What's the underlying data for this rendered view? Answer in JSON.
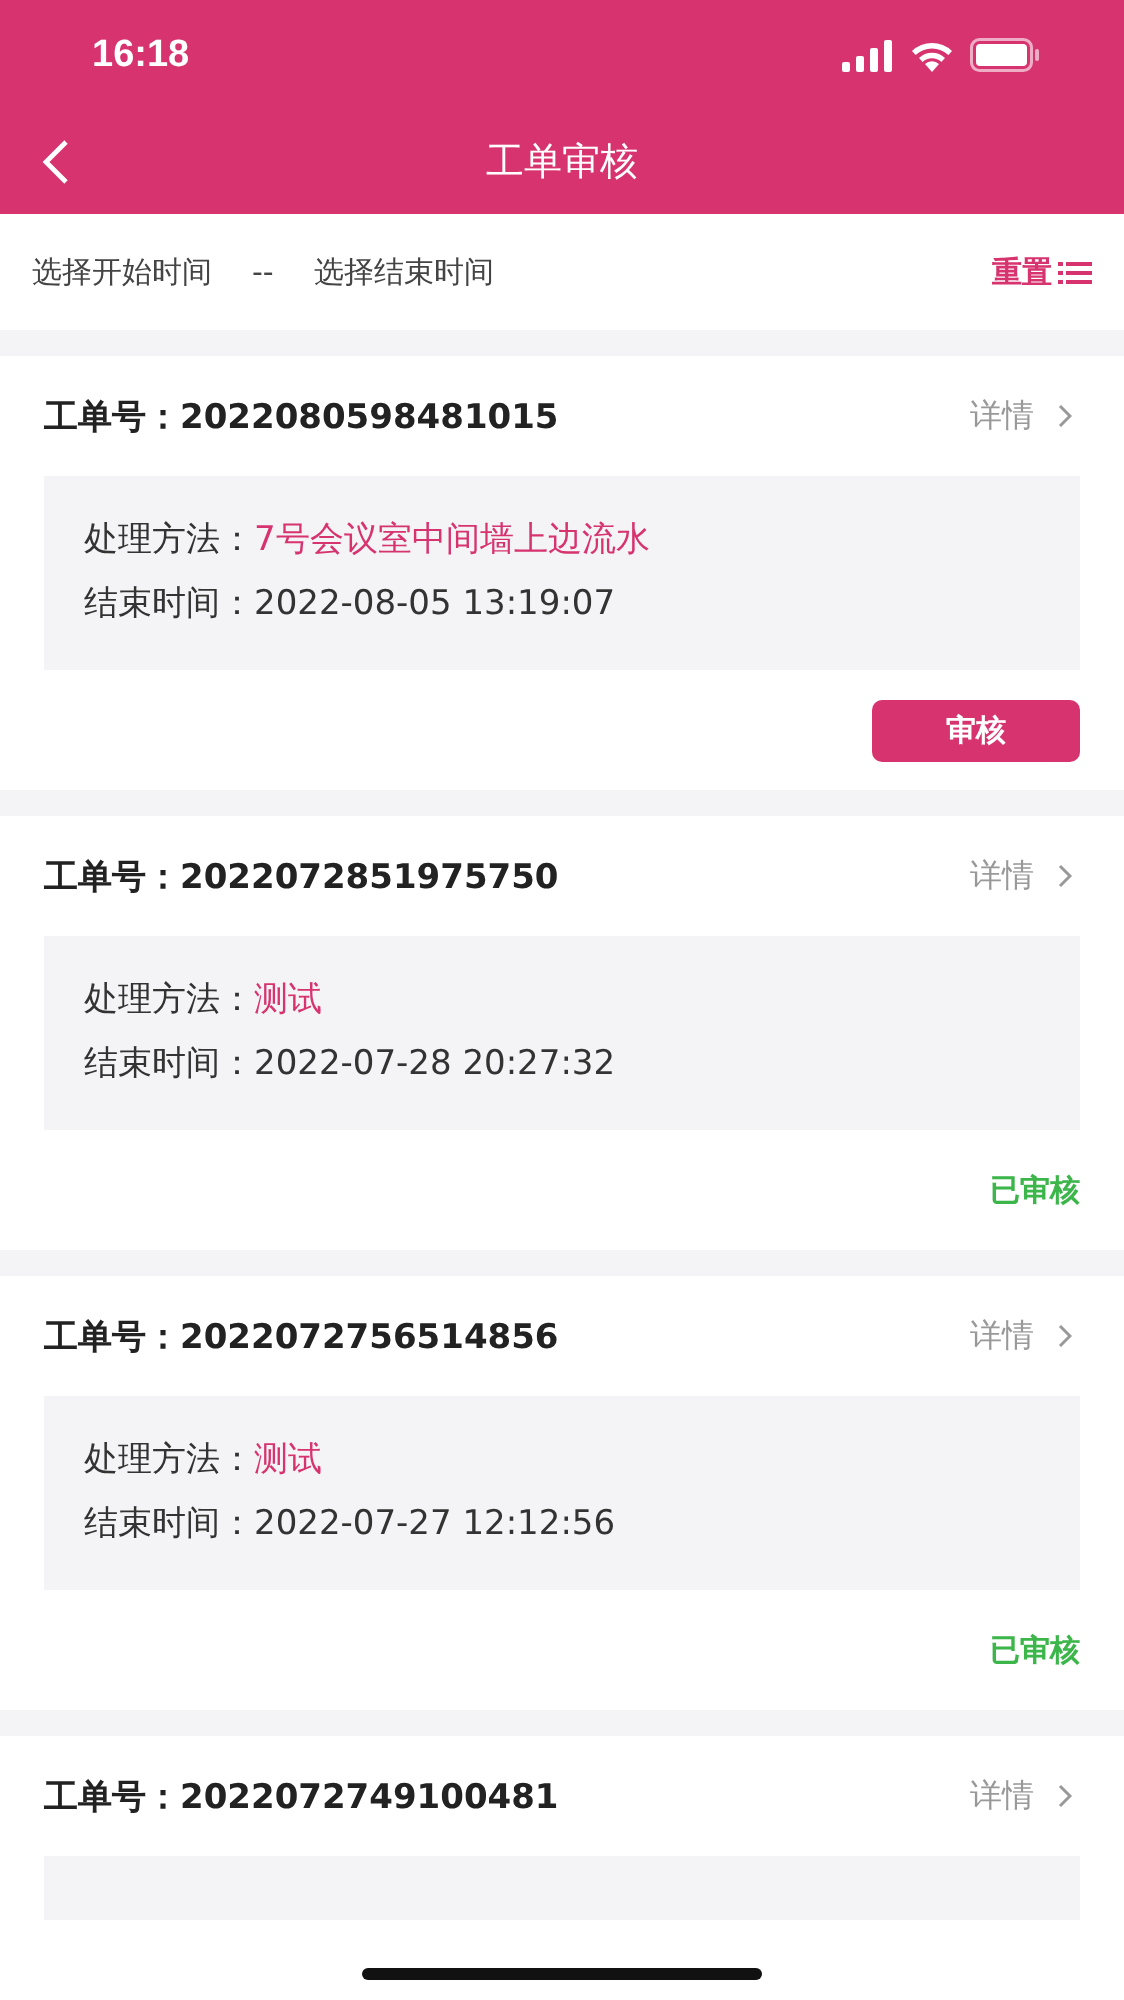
{
  "status_bar": {
    "time": "16:18"
  },
  "nav": {
    "title": "工单审核"
  },
  "filter": {
    "start_placeholder": "选择开始时间",
    "separator": "--",
    "end_placeholder": "选择结束时间",
    "reset": "重置"
  },
  "orders": [
    {
      "number_label": "工单号：",
      "number": "2022080598481015",
      "detail": "详情",
      "method_label": "处理方法：",
      "method": "7号会议室中间墙上边流水",
      "end_label": "结束时间：",
      "end_time": "2022-08-05 13:19:07",
      "action": {
        "kind": "button",
        "label": "审核"
      }
    },
    {
      "number_label": "工单号：",
      "number": "2022072851975750",
      "detail": "详情",
      "method_label": "处理方法：",
      "method": "测试",
      "end_label": "结束时间：",
      "end_time": "2022-07-28 20:27:32",
      "action": {
        "kind": "status",
        "label": "已审核"
      }
    },
    {
      "number_label": "工单号：",
      "number": "2022072756514856",
      "detail": "详情",
      "method_label": "处理方法：",
      "method": "测试",
      "end_label": "结束时间：",
      "end_time": "2022-07-27 12:12:56",
      "action": {
        "kind": "status",
        "label": "已审核"
      }
    },
    {
      "number_label": "工单号：",
      "number": "2022072749100481",
      "detail": "详情"
    }
  ]
}
